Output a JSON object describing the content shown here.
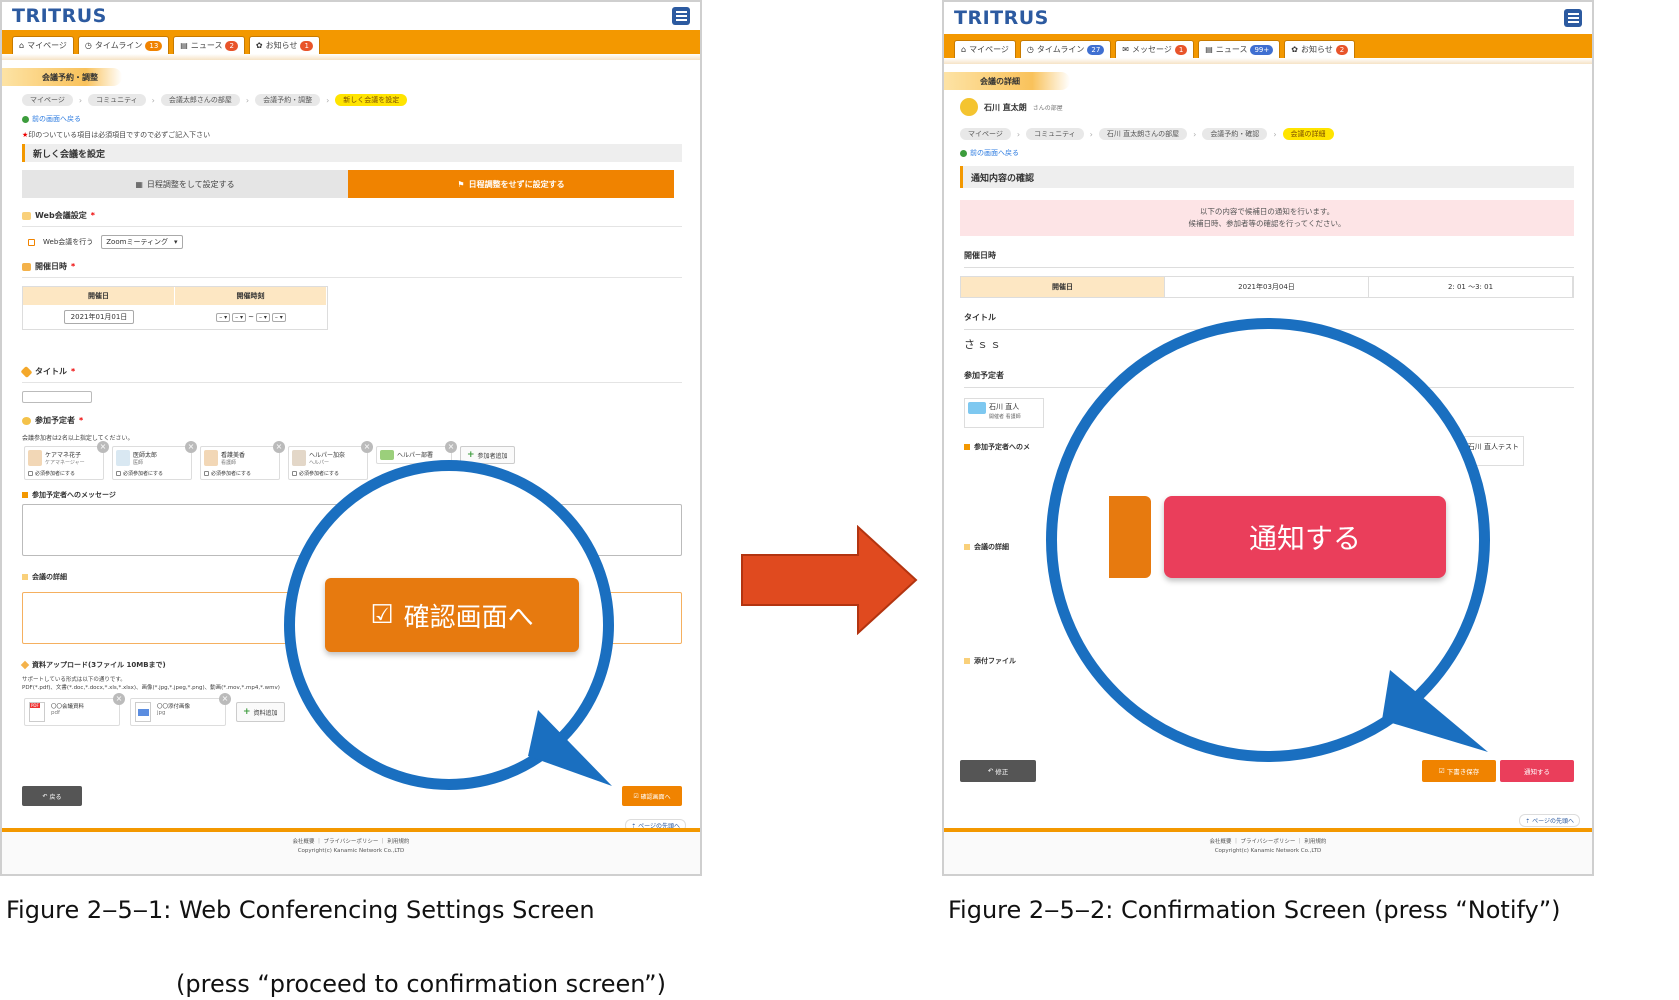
{
  "screen1": {
    "logo": "TRITRUS",
    "nav_tabs": [
      {
        "icon": "home-icon",
        "label": "マイページ",
        "badge": ""
      },
      {
        "icon": "clock-icon",
        "label": "タイムライン",
        "badge": "13"
      },
      {
        "icon": "news-icon",
        "label": "ニュース",
        "badge": "2"
      },
      {
        "icon": "gear-icon",
        "label": "お知らせ",
        "badge": "1"
      }
    ],
    "section": "会議予約・調整",
    "breadcrumbs": [
      "マイページ",
      "コミュニティ",
      "会議太郎さんの部屋",
      "会議予約・調整",
      "新しく会議を設定"
    ],
    "back_link": "前の画面へ戻る",
    "required_note": "印のついている項目は必須項目ですので必ずご記入下さい",
    "panel_title": "新しく会議を設定",
    "toggle_off": "日程調整をして設定する",
    "toggle_on": "日程調整をせずに設定する",
    "web_label": "Web会議設定",
    "web_check": "Web会議を行う",
    "web_select": "Zoomミーティング",
    "date_label": "開催日時",
    "date_col1": "開催日",
    "date_col2": "開催時刻",
    "date_value": "2021年01月01日",
    "title_label": "タイトル",
    "participants_label": "参加予定者",
    "participants_note": "会議参加者は2名以上指定してください。",
    "participants": [
      {
        "name": "ケアマネ花子",
        "role": "ケアマネージャー"
      },
      {
        "name": "医師太郎",
        "role": "医師"
      },
      {
        "name": "看護美香",
        "role": "看護師"
      },
      {
        "name": "ヘルパー加奈",
        "role": "ヘルパー"
      },
      {
        "name": "ヘルパー部署",
        "role": ""
      }
    ],
    "required_participant": "必須参加者にする",
    "add_participant": "参加者追加",
    "message_label": "参加予定者へのメッセージ",
    "details_label": "会議の詳細",
    "upload_label": "資料アップロード(3ファイル 10MBまで)",
    "upload_note1": "サポートしている形式は以下の通りです。",
    "upload_note2": "PDF(*.pdf)、文書(*.doc,*.docx,*.xls,*.xlsx)、画像(*.jpg,*.jpeg,*.png)、動画(*.mov,*.mp4,*.wmv)",
    "files": [
      {
        "name": "〇〇会議資料",
        "ext": "pdf"
      },
      {
        "name": "〇〇添付画像",
        "ext": "jpg"
      }
    ],
    "add_file": "資料追加",
    "back_button": "戻る",
    "confirm_button_small": "確認画面へ",
    "to_top": "ページの先頭へ",
    "footer_links": "会社概要 ｜ プライバシーポリシー ｜ 利用規約",
    "footer_copy": "Copyright(c) Kanamic Network Co.,LTD",
    "zoom_button": "確認画面へ"
  },
  "screen2": {
    "logo": "TRITRUS",
    "nav_tabs": [
      {
        "icon": "home-icon",
        "label": "マイページ",
        "badge": ""
      },
      {
        "icon": "clock-icon",
        "label": "タイムライン",
        "badge": "27"
      },
      {
        "icon": "message-icon",
        "label": "メッセージ",
        "badge": "1"
      },
      {
        "icon": "news-icon",
        "label": "ニュース",
        "badge": "99+"
      },
      {
        "icon": "gear-icon",
        "label": "お知らせ",
        "badge": "2"
      }
    ],
    "section": "会議の詳細",
    "room_name": "石川 直太朗",
    "room_suffix": "さんの部屋",
    "breadcrumbs": [
      "マイページ",
      "コミュニティ",
      "石川 直太朗さんの部屋",
      "会議予約・確認",
      "会議の詳細"
    ],
    "back_link": "前の画面へ戻る",
    "panel_title": "通知内容の確認",
    "confirm_line1": "以下の内容で候補日の通知を行います。",
    "confirm_line2": "候補日時、参加者等の確認を行ってください。",
    "date_label": "開催日時",
    "date_col": "開催日",
    "date_value": "2021年03月04日",
    "time_value": "2: 01 ～3: 01",
    "title_label": "タイトル",
    "title_value": "さｓｓ",
    "participants_label": "参加予定者",
    "participant1": "石川 直人",
    "participant1_tags": "開催者 看護師",
    "participant2": "石川 直人テスト",
    "message_label": "参加予定者へのメ",
    "details_label": "会議の詳細",
    "attach_label": "添付ファイル",
    "fix_button": "修正",
    "draft_button": "下書き保存",
    "notify_button_small": "通知する",
    "to_top": "ページの先頭へ",
    "footer_links": "会社概要 ｜ プライバシーポリシー ｜ 利用規約",
    "footer_copy": "Copyright(c) Kanamic Network Co.,LTD",
    "zoom_button": "通知する"
  },
  "captions": {
    "fig1_line1": "Figure 2‒5‒1: Web Conferencing Settings Screen",
    "fig1_line2": "(press “proceed to confirmation screen”)",
    "fig2": "Figure 2‒5‒2: Confirmation Screen (press “Notify”)"
  },
  "colors": {
    "accent_orange": "#f39800",
    "button_orange": "#e77a0f",
    "notify_red": "#ea3e5b",
    "bubble_blue": "#1a6fc0",
    "arrow_red": "#e04a1f"
  }
}
